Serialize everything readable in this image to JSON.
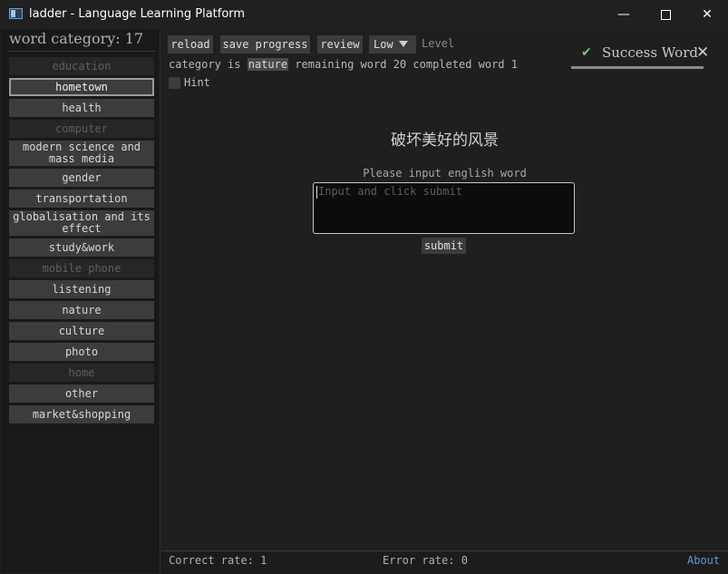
{
  "window": {
    "title": "ladder - Language Learning Platform",
    "minimize": "—",
    "close": "✕"
  },
  "sidebar": {
    "title": "word category: 17",
    "categories": [
      {
        "label": "education",
        "state": "disabled"
      },
      {
        "label": "hometown",
        "state": "selected"
      },
      {
        "label": "health",
        "state": "normal"
      },
      {
        "label": "computer",
        "state": "disabled"
      },
      {
        "label": "modern science and mass media",
        "state": "normal"
      },
      {
        "label": "gender",
        "state": "normal"
      },
      {
        "label": "transportation",
        "state": "normal"
      },
      {
        "label": "globalisation and its effect",
        "state": "normal"
      },
      {
        "label": "study&work",
        "state": "normal"
      },
      {
        "label": "mobile phone",
        "state": "disabled"
      },
      {
        "label": "listening",
        "state": "normal"
      },
      {
        "label": "nature",
        "state": "normal"
      },
      {
        "label": "culture",
        "state": "normal"
      },
      {
        "label": "photo",
        "state": "normal"
      },
      {
        "label": "home",
        "state": "disabled"
      },
      {
        "label": "other",
        "state": "normal"
      },
      {
        "label": "market&shopping",
        "state": "normal"
      }
    ]
  },
  "toolbar": {
    "reload": "reload",
    "save_progress": "save progress",
    "review": "review",
    "level_value": "Low",
    "level_label": "Level"
  },
  "status": {
    "category_prefix": "category is",
    "category": "nature",
    "remaining_label": "remaining word",
    "remaining": "20",
    "completed_label": "completed word",
    "completed": "1"
  },
  "hint": {
    "label": "Hint",
    "checked": false
  },
  "toast": {
    "text": "Success Word",
    "close": "✕",
    "check": "✔"
  },
  "quiz": {
    "prompt": "破坏美好的风景",
    "input_label": "Please input english word",
    "placeholder": "Input and click submit",
    "submit": "submit"
  },
  "footer": {
    "correct_rate": "Correct rate: 1",
    "error_rate": "Error rate: 0",
    "about": "About"
  },
  "colors": {
    "background": "#1f1f1f",
    "button": "#3c3c3c",
    "link": "#5b9bd5",
    "success": "#7fc27f"
  }
}
